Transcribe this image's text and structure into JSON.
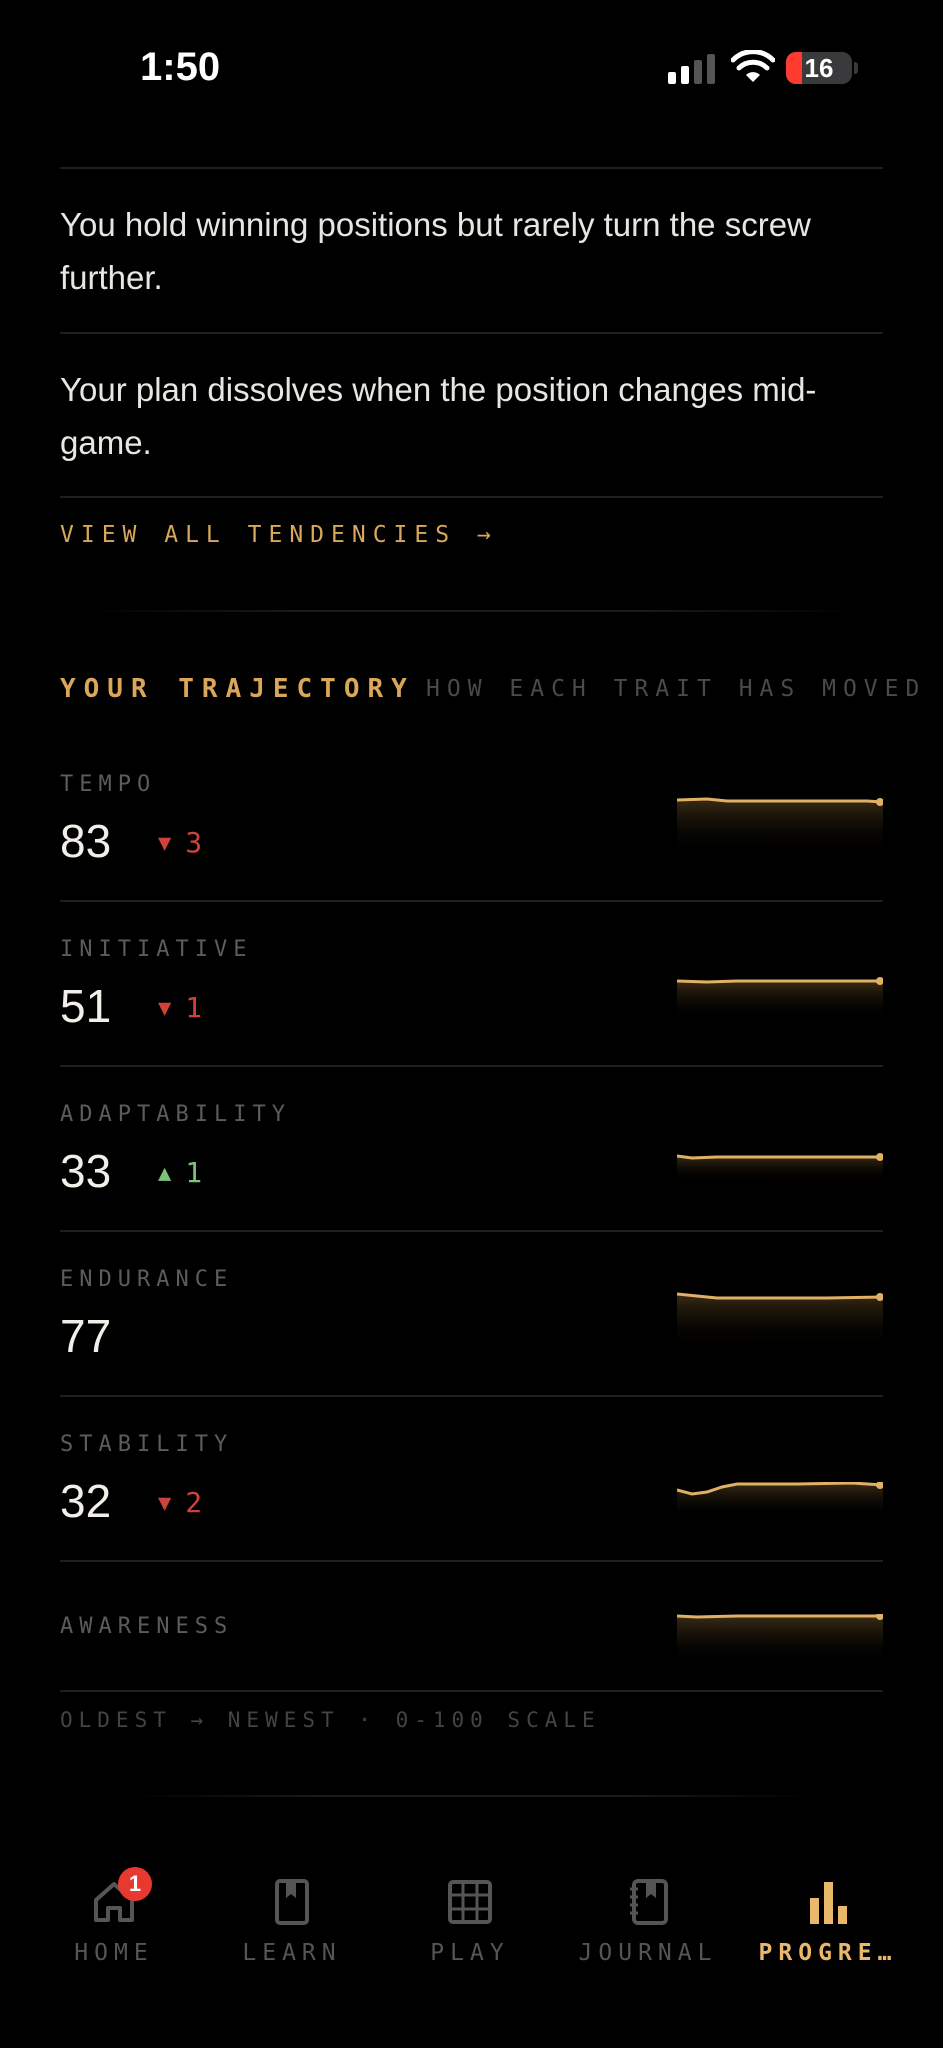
{
  "status_bar": {
    "time": "1:50",
    "battery": "16"
  },
  "tendencies": [
    "You hold winning positions but rarely turn the screw further.",
    "Your plan dissolves when the position changes mid-game."
  ],
  "view_all_link": "VIEW ALL TENDENCIES →",
  "trajectory": {
    "title": "YOUR TRAJECTORY",
    "subtitle": "HOW EACH TRAIT HAS MOVED",
    "traits": [
      {
        "label": "TEMPO",
        "value": "83",
        "delta": "3",
        "direction": "down"
      },
      {
        "label": "INITIATIVE",
        "value": "51",
        "delta": "1",
        "direction": "down"
      },
      {
        "label": "ADAPTABILITY",
        "value": "33",
        "delta": "1",
        "direction": "up"
      },
      {
        "label": "ENDURANCE",
        "value": "77",
        "delta": "",
        "direction": "none"
      },
      {
        "label": "STABILITY",
        "value": "32",
        "delta": "2",
        "direction": "down"
      },
      {
        "label": "AWARENESS",
        "value": "",
        "delta": "",
        "direction": "none"
      }
    ],
    "footer": "OLDEST → NEWEST · 0-100 SCALE"
  },
  "nav": {
    "items": [
      {
        "label": "HOME",
        "icon": "home-icon"
      },
      {
        "label": "LEARN",
        "icon": "book-icon"
      },
      {
        "label": "PLAY",
        "icon": "board-icon"
      },
      {
        "label": "JOURNAL",
        "icon": "journal-icon"
      },
      {
        "label": "PROGRE…",
        "icon": "bar-chart-icon"
      }
    ],
    "home_badge": "1",
    "active": "PROGRE…"
  },
  "colors": {
    "accent": "#d9a65b",
    "down": "#d0423b",
    "up": "#7ac27a",
    "background": "#000000"
  }
}
